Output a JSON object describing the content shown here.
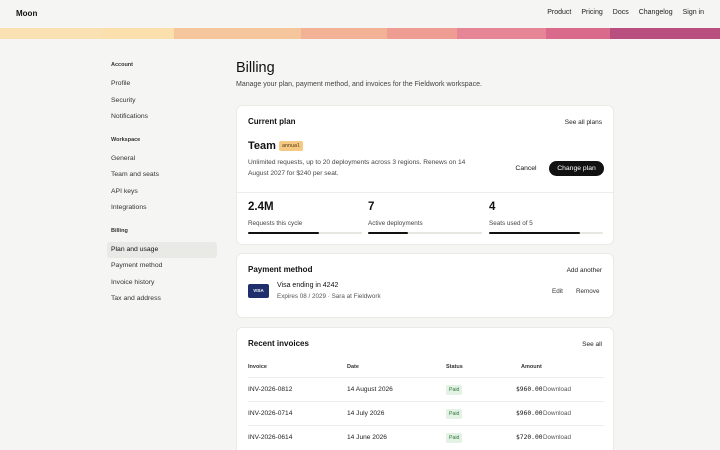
{
  "app": {
    "brand": "Moon"
  },
  "nav": [
    "Product",
    "Pricing",
    "Docs",
    "Changelog",
    "Sign in"
  ],
  "band_colors": [
    "#f9e1b4",
    "#fbe0ad",
    "#f5c59b",
    "#f2b296",
    "#ef9c93",
    "#e58595",
    "#d96a8c",
    "#b84f7f"
  ],
  "sidebar": {
    "account_title": "Account",
    "account_items": [
      "Profile",
      "Security",
      "Notifications"
    ],
    "workspace_title": "Workspace",
    "workspace_items": [
      "General",
      "Team and seats",
      "API keys",
      "Integrations"
    ],
    "billing_title": "Billing",
    "billing_items": [
      "Plan and usage",
      "Payment method",
      "Invoice history",
      "Tax and address"
    ]
  },
  "page": {
    "title": "Billing",
    "subtitle": "Manage your plan, payment method, and invoices for the Fieldwork workspace."
  },
  "current_plan": {
    "heading": "Current plan",
    "link": "See all plans",
    "name": "Team",
    "badge": "annual",
    "description": "Unlimited requests, up to 20 deployments across 3 regions. Renews on 14 August 2027 for $240 per seat.",
    "cancel": "Cancel",
    "change": "Change plan",
    "stats": [
      {
        "value": "2.4M",
        "label": "Requests this cycle",
        "fill": 0.62
      },
      {
        "value": "7",
        "label": "Active deployments",
        "fill": 0.35
      },
      {
        "value": "4",
        "label": "Seats used of 5",
        "fill": 0.8
      }
    ]
  },
  "payment": {
    "heading": "Payment method",
    "link": "Add another",
    "card_brand": "VISA",
    "title": "Visa ending in 4242",
    "sub": "Expires 08 / 2029 · Sara at Fieldwork",
    "edit": "Edit",
    "remove": "Remove"
  },
  "invoices": {
    "heading": "Recent invoices",
    "link": "See all",
    "columns": [
      "Invoice",
      "Date",
      "Status",
      "Amount"
    ],
    "rows": [
      {
        "id": "INV-2026-0812",
        "date": "14 August 2026",
        "status": "Paid",
        "amount": "$960.00",
        "action": "Download"
      },
      {
        "id": "INV-2026-0714",
        "date": "14 July 2026",
        "status": "Paid",
        "amount": "$960.00",
        "action": "Download"
      },
      {
        "id": "INV-2026-0614",
        "date": "14 June 2026",
        "status": "Paid",
        "amount": "$720.00",
        "action": "Download"
      }
    ]
  }
}
